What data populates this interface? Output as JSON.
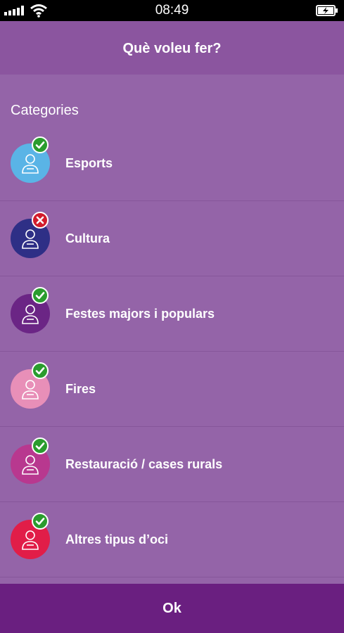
{
  "status_bar": {
    "time": "08:49",
    "icons": [
      "signal-icon",
      "wifi-icon",
      "battery-charging-icon"
    ]
  },
  "header": {
    "title": "Què voleu fer?"
  },
  "section": {
    "title": "Categories"
  },
  "categories": [
    {
      "label": "Esports",
      "icon": "sports-person-icon",
      "color": "#5ab4e6",
      "status": "checked"
    },
    {
      "label": "Cultura",
      "icon": "culture-person-icon",
      "color": "#2e2f86",
      "status": "unchecked"
    },
    {
      "label": "Festes majors i populars",
      "icon": "festival-person-icon",
      "color": "#6b2585",
      "status": "checked"
    },
    {
      "label": "Fires",
      "icon": "fair-person-icon",
      "color": "#e88fb8",
      "status": "checked"
    },
    {
      "label": "Restauració / cases rurals",
      "icon": "chef-person-icon",
      "color": "#b8388f",
      "status": "checked"
    },
    {
      "label": "Altres tipus d’oci",
      "icon": "leisure-person-icon",
      "color": "#e11d48",
      "status": "checked"
    }
  ],
  "footer": {
    "ok_label": "Ok"
  },
  "colors": {
    "header": "#8b559f",
    "background": "#9464a8",
    "footer": "#6a1f80",
    "check": "#2a9c2e",
    "cross": "#d11c2c"
  }
}
